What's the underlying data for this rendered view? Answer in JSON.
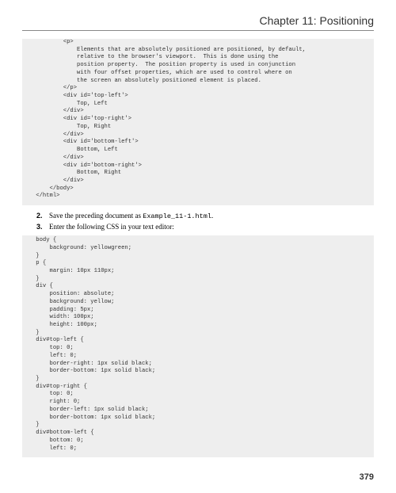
{
  "header": "Chapter 11: Positioning",
  "code1": "            <p>\n                Elements that are absolutely positioned are positioned, by default,\n                relative to the browser's viewport.  This is done using the\n                position property.  The position property is used in conjunction\n                with four offset properties, which are used to control where on\n                the screen an absolutely positioned element is placed.\n            </p>\n            <div id='top-left'>\n                Top, Left\n            </div>\n            <div id='top-right'>\n                Top, Right\n            </div>\n            <div id='bottom-left'>\n                Bottom, Left\n            </div>\n            <div id='bottom-right'>\n                Bottom, Right\n            </div>\n        </body>\n    </html>",
  "step2_num": "2.",
  "step2_a": "Save the preceding document as ",
  "step2_b": "Example_11-1.html",
  "step2_c": ".",
  "step3_num": "3.",
  "step3": "Enter the following CSS in your text editor:",
  "code2": "    body {\n        background: yellowgreen;\n    }\n    p {\n        margin: 10px 110px;\n    }\n    div {\n        position: absolute;\n        background: yellow;\n        padding: 5px;\n        width: 100px;\n        height: 100px;\n    }\n    div#top-left {\n        top: 0;\n        left: 0;\n        border-right: 1px solid black;\n        border-bottom: 1px solid black;\n    }\n    div#top-right {\n        top: 0;\n        right: 0;\n        border-left: 1px solid black;\n        border-bottom: 1px solid black;\n    }\n    div#bottom-left {\n        bottom: 0;\n        left: 0;",
  "page_number": "379"
}
